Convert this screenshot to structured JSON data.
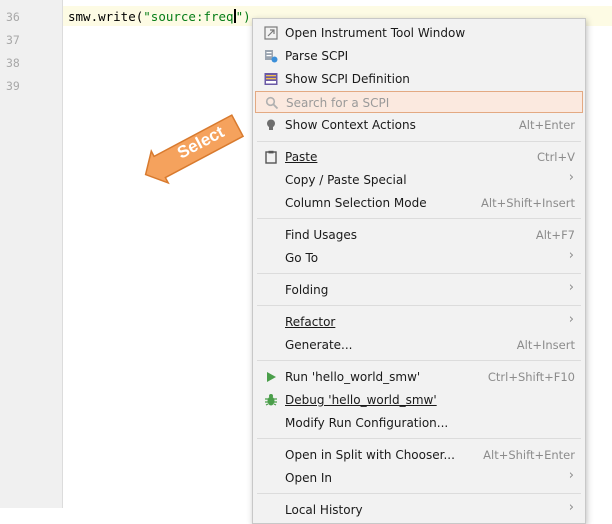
{
  "editor": {
    "line_numbers": [
      "36",
      "37",
      "38",
      "39"
    ],
    "code": {
      "prefix": "smw.write(",
      "string": "\"source:freq",
      "string_end": "\")"
    }
  },
  "callout": {
    "text": "Select",
    "color": "#f5a25d"
  },
  "menu": {
    "items": [
      {
        "label": "Open Instrument Tool Window",
        "shortcut": "",
        "icon": "instrument-window-icon"
      },
      {
        "label": "Parse SCPI",
        "shortcut": "",
        "icon": "parse-scpi-icon"
      },
      {
        "label": "Show SCPI Definition",
        "shortcut": "",
        "icon": "scpi-definition-icon"
      },
      {
        "label": "Search for a SCPI",
        "shortcut": "",
        "icon": "search-scpi-icon"
      },
      {
        "label": "Show Context Actions",
        "shortcut": "Alt+Enter",
        "icon": "lightbulb-icon"
      },
      {
        "label": "Paste",
        "shortcut": "Ctrl+V",
        "icon": "clipboard-icon"
      },
      {
        "label": "Copy / Paste Special",
        "shortcut": ""
      },
      {
        "label": "Column Selection Mode",
        "shortcut": "Alt+Shift+Insert"
      },
      {
        "label": "Find Usages",
        "shortcut": "Alt+F7"
      },
      {
        "label": "Go To",
        "shortcut": ""
      },
      {
        "label": "Folding",
        "shortcut": ""
      },
      {
        "label": "Refactor",
        "shortcut": ""
      },
      {
        "label": "Generate...",
        "shortcut": "Alt+Insert"
      },
      {
        "label": "Run 'hello_world_smw'",
        "shortcut": "Ctrl+Shift+F10",
        "icon": "run-icon"
      },
      {
        "label": "Debug 'hello_world_smw'",
        "shortcut": "",
        "icon": "debug-bug-icon"
      },
      {
        "label": "Modify Run Configuration...",
        "shortcut": ""
      },
      {
        "label": "Open in Split with Chooser...",
        "shortcut": "Alt+Shift+Enter"
      },
      {
        "label": "Open In",
        "shortcut": ""
      },
      {
        "label": "Local History",
        "shortcut": ""
      }
    ]
  }
}
